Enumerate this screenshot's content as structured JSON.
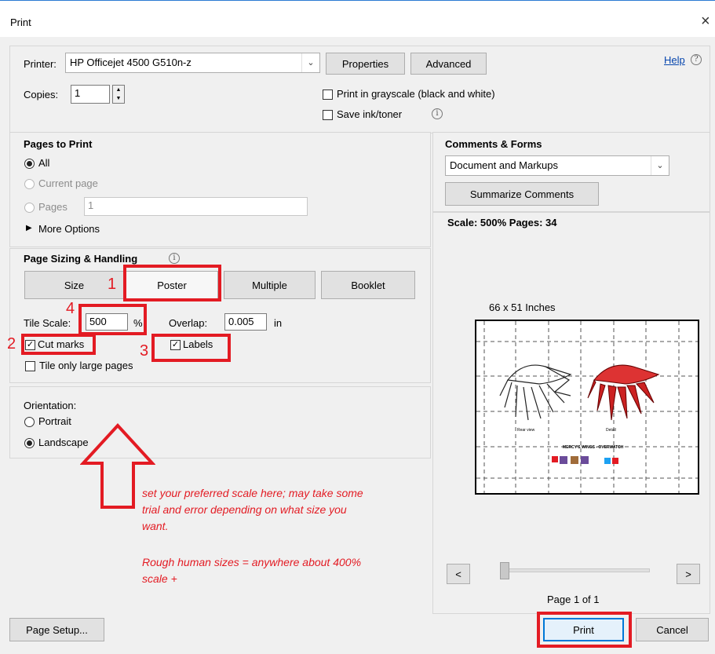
{
  "window": {
    "title": "Print",
    "close": "×"
  },
  "printer": {
    "label": "Printer:",
    "value": "HP Officejet 4500 G510n-z",
    "properties": "Properties",
    "advanced": "Advanced"
  },
  "help": {
    "label": "Help",
    "icon": "?"
  },
  "copies": {
    "label": "Copies:",
    "value": "1"
  },
  "options": {
    "grayscale": "Print in grayscale (black and white)",
    "save_ink": "Save ink/toner"
  },
  "pages_to_print": {
    "title": "Pages to Print",
    "all": "All",
    "current": "Current page",
    "pages": "Pages",
    "pages_value": "1",
    "more": "More Options"
  },
  "sizing": {
    "title": "Page Sizing & Handling",
    "tabs": [
      "Size",
      "Poster",
      "Multiple",
      "Booklet"
    ],
    "tile_scale_label": "Tile Scale:",
    "tile_scale_value": "500",
    "percent": "%",
    "overlap_label": "Overlap:",
    "overlap_value": "0.005",
    "overlap_unit": "in",
    "cut_marks": "Cut marks",
    "labels": "Labels",
    "tile_large": "Tile only large pages"
  },
  "orientation": {
    "title": "Orientation:",
    "portrait": "Portrait",
    "landscape": "Landscape"
  },
  "comments": {
    "title": "Comments & Forms",
    "value": "Document and Markups",
    "summarize": "Summarize Comments"
  },
  "preview": {
    "scale_text": "Scale: 500% Pages: 34",
    "dimensions": "66 x 51 Inches",
    "page_info": "Page 1 of 1",
    "prev": "<",
    "next": ">",
    "thumb_title": "MERCY'S WINGS - OVERWATCH",
    "thumb_caption_left": "Rear view",
    "thumb_caption_right": "Detail"
  },
  "footer": {
    "page_setup": "Page Setup...",
    "print": "Print",
    "cancel": "Cancel"
  },
  "annotations": {
    "n1": "1",
    "n2": "2",
    "n3": "3",
    "n4": "4",
    "line1": "set your preferred scale here; may take some",
    "line2": "trial and error depending on what size you",
    "line3": "want.",
    "line4": "Rough human sizes = anywhere about 400%",
    "line5": "scale +"
  },
  "colors": {
    "accent_red": "#e31b23",
    "title_border": "#2b7bd3"
  }
}
